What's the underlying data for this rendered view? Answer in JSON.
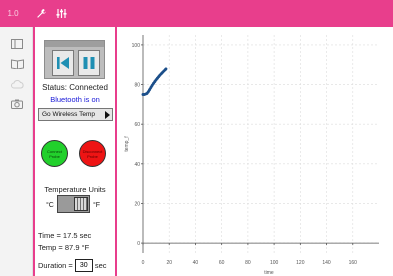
{
  "topbar": {
    "logo": "1.0",
    "icons": [
      "wrench-icon",
      "sliders-icon"
    ],
    "color": "#e83e8c"
  },
  "leftrail": {
    "icons": [
      "panel-toggle-icon",
      "book-icon",
      "cloud-icon",
      "camera-icon"
    ]
  },
  "panel": {
    "status_text": "Status: Connected",
    "bluetooth_text": "Bluetooth is on",
    "sensor_dropdown": "Go Wireless Temp",
    "connect_button_label": "Connect Probe",
    "disconnect_button_label": "Disconnect Probe",
    "units_label": "Temperature Units",
    "unit_c": "°C",
    "unit_f": "°F",
    "units_selected": "°F",
    "time_readout": "Time = 17.5 sec",
    "temp_readout": "Temp = 87.9 °F",
    "duration_label": "Duration =",
    "duration_value": "30",
    "duration_unit": "sec"
  },
  "chart_data": {
    "type": "line",
    "xlabel": "time",
    "ylabel": "temp_f",
    "xlim": [
      0,
      180
    ],
    "ylim": [
      -5,
      105
    ],
    "xticks": [
      0,
      20,
      40,
      60,
      80,
      100,
      120,
      140,
      160
    ],
    "yticks": [
      0,
      20,
      40,
      60,
      80,
      100
    ],
    "grid": true,
    "series": [
      {
        "x": [
          0,
          1,
          2,
          3,
          4,
          5,
          6,
          7,
          8,
          9,
          10,
          11,
          12,
          13,
          14,
          15,
          16,
          17,
          17.5
        ],
        "y": [
          75,
          75,
          75.2,
          75.5,
          76.3,
          77.4,
          78.5,
          79.6,
          80.6,
          81.5,
          82.4,
          83.2,
          84,
          84.8,
          85.5,
          86.2,
          86.9,
          87.5,
          87.9
        ],
        "color": "#1c4f8a"
      }
    ]
  }
}
